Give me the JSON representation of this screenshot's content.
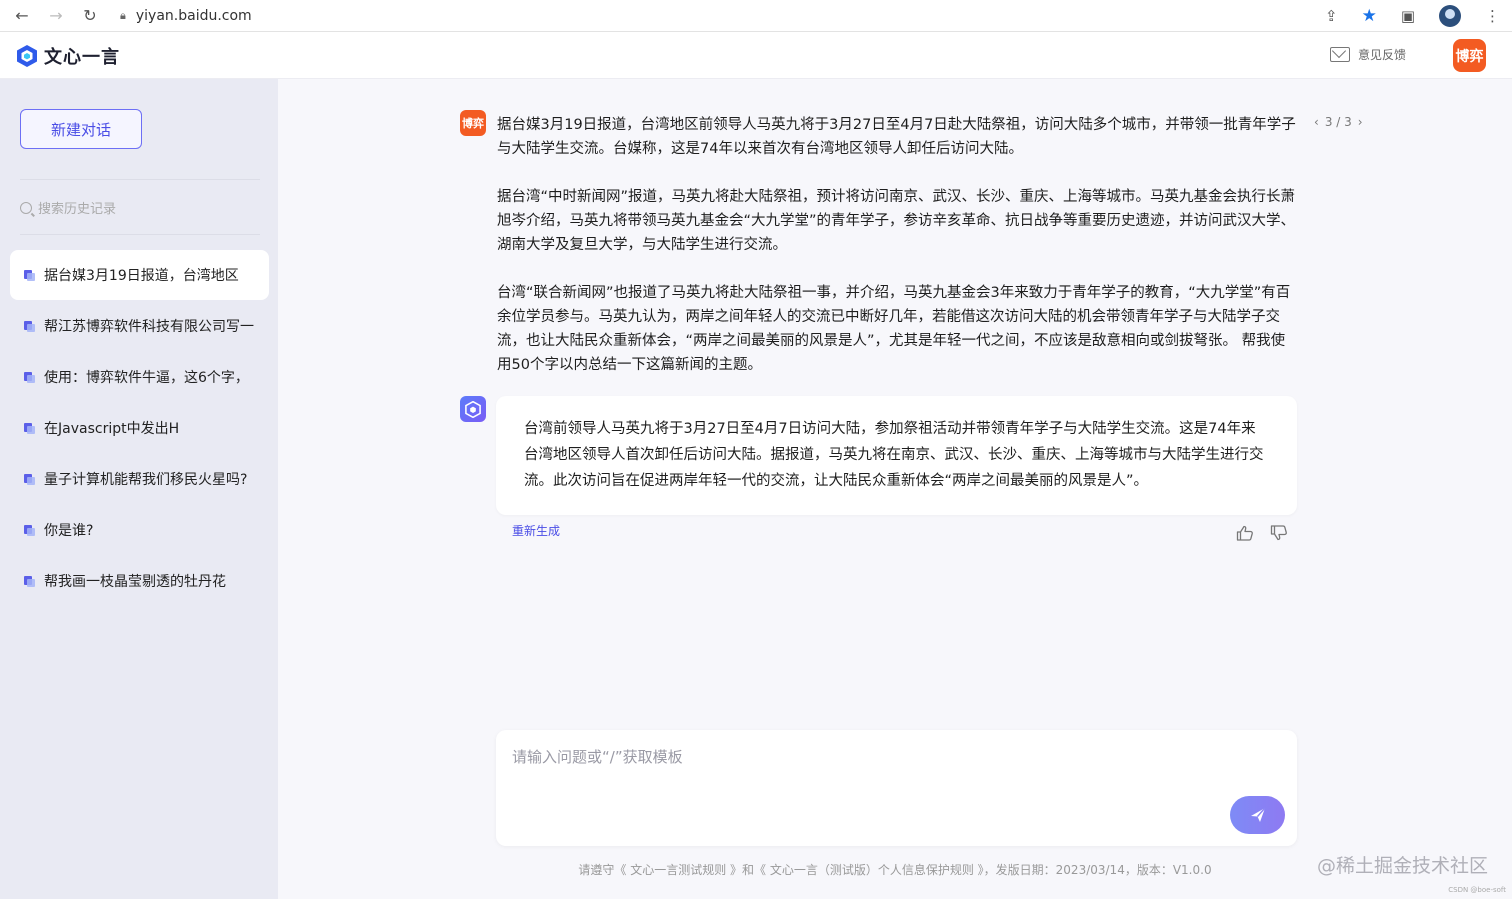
{
  "browser": {
    "url": "yiyan.baidu.com"
  },
  "header": {
    "app_name": "文心一言",
    "feedback_label": "意见反馈",
    "user_avatar_text": "博弈"
  },
  "sidebar": {
    "new_chat_label": "新建对话",
    "search_placeholder": "搜索历史记录",
    "history": [
      {
        "label": "据台媒3月19日报道，台湾地区",
        "active": true
      },
      {
        "label": "帮江苏博弈软件科技有限公司写一",
        "active": false
      },
      {
        "label": "使用：博弈软件牛逼，这6个字，",
        "active": false
      },
      {
        "label": "在Javascript中发出H",
        "active": false
      },
      {
        "label": "量子计算机能帮我们移民火星吗?",
        "active": false
      },
      {
        "label": "你是谁?",
        "active": false
      },
      {
        "label": "帮我画一枝晶莹剔透的牡丹花",
        "active": false
      }
    ]
  },
  "chat": {
    "user_avatar_text": "博弈",
    "user_message": [
      "据台媒3月19日报道，台湾地区前领导人马英九将于3月27日至4月7日赴大陆祭祖，访问大陆多个城市，并带领一批青年学子与大陆学生交流。台媒称，这是74年以来首次有台湾地区领导人卸任后访问大陆。",
      "据台湾“中时新闻网”报道，马英九将赴大陆祭祖，预计将访问南京、武汉、长沙、重庆、上海等城市。马英九基金会执行长萧旭岑介绍，马英九将带领马英九基金会“大九学堂”的青年学子，参访辛亥革命、抗日战争等重要历史遗迹，并访问武汉大学、湖南大学及复旦大学，与大陆学生进行交流。",
      "台湾“联合新闻网”也报道了马英九将赴大陆祭祖一事，并介绍，马英九基金会3年来致力于青年学子的教育，“大九学堂”有百余位学员参与。马英九认为，两岸之间年轻人的交流已中断好几年，若能借这次访问大陆的机会带领青年学子与大陆学子交流，也让大陆民众重新体会，“两岸之间最美丽的风景是人”，尤其是年轻一代之间，不应该是敌意相向或剑拔弩张。 帮我使用50个字以内总结一下这篇新闻的主题。"
    ],
    "pager": {
      "prev": "‹",
      "current": "3 / 3",
      "next": "›"
    },
    "bot_reply": "台湾前领导人马英九将于3月27日至4月7日访问大陆，参加祭祖活动并带领青年学子与大陆学生交流。这是74年来台湾地区领导人首次卸任后访问大陆。据报道，马英九将在南京、武汉、长沙、重庆、上海等城市与大陆学生进行交流。此次访问旨在促进两岸年轻一代的交流，让大陆民众重新体会“两岸之间最美丽的风景是人”。",
    "regenerate_label": "重新生成"
  },
  "input": {
    "placeholder": "请输入问题或“/”获取模板"
  },
  "footer": {
    "text": "请遵守《 文心一言测试规则 》和《 文心一言（测试版）个人信息保护规则 》，发版日期：2023/03/14，版本：V1.0.0"
  },
  "overlay": {
    "site_watermark": "@稀土掘金技术社区",
    "csdn_mark": "CSDN @boe-soft"
  },
  "colors": {
    "accent": "#4a4de6",
    "user_avatar": "#f35b22",
    "sidebar_bg": "#e9eaf3"
  }
}
